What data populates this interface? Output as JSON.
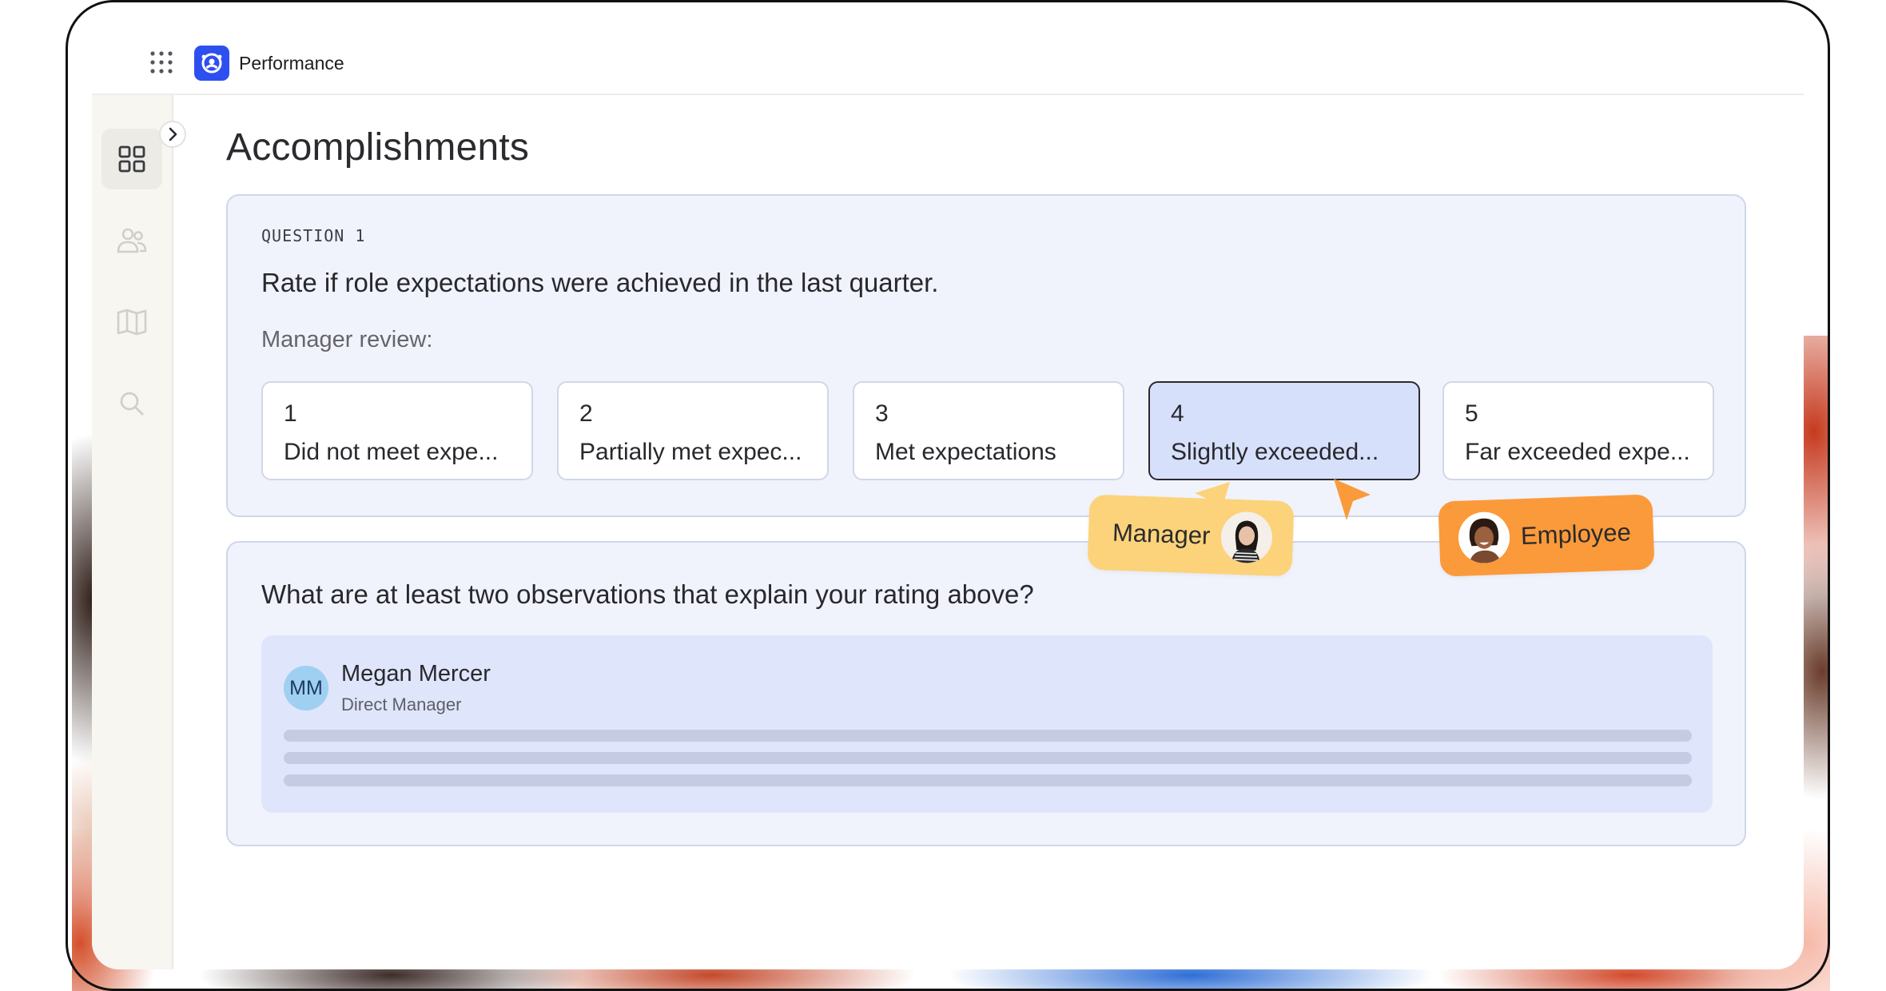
{
  "app": {
    "name": "Performance",
    "accent": "#2e4ff0"
  },
  "icons": {
    "apps": "apps-grid-icon",
    "logo": "performance-logo-icon",
    "dashboard": "dashboard-grid-icon",
    "people": "people-icon",
    "book": "book-icon",
    "search": "search-icon",
    "expand": "chevron-right-icon"
  },
  "page": {
    "title": "Accomplishments"
  },
  "question1": {
    "label": "QUESTION 1",
    "text": "Rate if role expectations were achieved in the last quarter.",
    "review_label": "Manager review:",
    "options": [
      {
        "num": "1",
        "label": "Did not meet expe..."
      },
      {
        "num": "2",
        "label": "Partially met expec..."
      },
      {
        "num": "3",
        "label": "Met expectations"
      },
      {
        "num": "4",
        "label": "Slightly exceeded..."
      },
      {
        "num": "5",
        "label": "Far exceeded expe..."
      }
    ],
    "selected": "4"
  },
  "cursors": {
    "manager": {
      "label": "Manager",
      "color": "#fcd37a"
    },
    "employee": {
      "label": "Employee",
      "color": "#fb9a3a"
    }
  },
  "question2": {
    "text": "What are at least two observations that explain your rating above?",
    "response": {
      "initials": "MM",
      "name": "Megan Mercer",
      "role": "Direct Manager"
    }
  }
}
